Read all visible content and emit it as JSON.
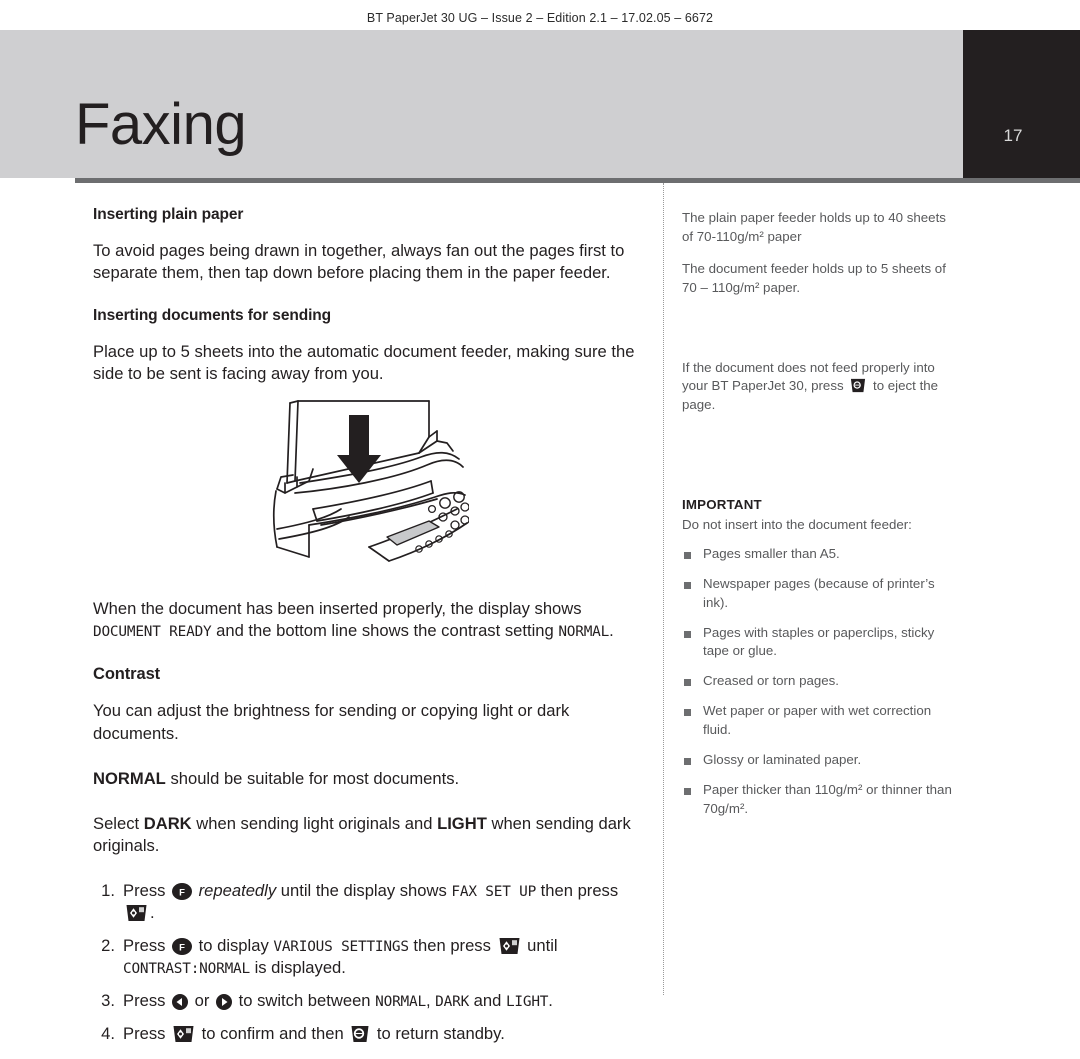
{
  "header": {
    "running_head": "BT PaperJet 30 UG – Issue 2 – Edition 2.1 – 17.02.05 – 6672",
    "chapter_title": "Faxing",
    "page_number": "17",
    "band_color": "#cfcfd1",
    "page_block_color": "#231f20",
    "rule_color": "#6d6e70"
  },
  "main": {
    "section1_heading": "Inserting plain paper",
    "section1_para": "To avoid pages being drawn in together, always fan out the pages first to separate them, then tap down before placing them in the paper feeder.",
    "section2_heading": "Inserting documents for sending",
    "section2_para": "Place up to 5 sheets into the automatic document feeder, making sure the side to be sent is facing away from you.",
    "figure_name": "fax-machine-document-feeder-illustration",
    "after_figure": {
      "part1": "When the document has been inserted properly, the display shows ",
      "lcd1": "DOCUMENT READY",
      "part2": " and the bottom line shows the contrast setting ",
      "lcd2": "NORMAL",
      "part3": "."
    },
    "contrast_heading": "Contrast",
    "contrast_para1": "You can adjust the brightness for sending or copying light or dark documents.",
    "contrast_para2": {
      "bold": "NORMAL",
      "rest": " should be suitable for most documents."
    },
    "contrast_para3": {
      "pre": "Select ",
      "bold1": "DARK",
      "mid": " when sending light originals and ",
      "bold2": "LIGHT",
      "post": " when sending dark originals."
    },
    "steps": [
      {
        "num": "1.",
        "t1": "Press ",
        "icon1": "function-key-f",
        "t2": " ",
        "italic": "repeatedly",
        "t3": " until the display shows ",
        "lcd1": "FAX SET UP",
        "t4": " then press ",
        "icon2": "start-key",
        "t5": "."
      },
      {
        "num": "2.",
        "t1": "Press ",
        "icon1": "function-key-f",
        "t2": " to display ",
        "lcd1": "VARIOUS SETTINGS",
        "t3": " then press ",
        "icon2": "start-key",
        "t4": " until ",
        "lcd2": "CONTRAST:NORMAL",
        "t5": " is displayed."
      },
      {
        "num": "3.",
        "t1": "Press ",
        "icon1": "arrow-left-key",
        "t2": " or ",
        "icon2": "arrow-right-key",
        "t3": " to switch between ",
        "lcd1": "NORMAL",
        "t4": ", ",
        "lcd2": "DARK",
        "t5": " and ",
        "lcd3": "LIGHT",
        "t6": "."
      },
      {
        "num": "4.",
        "t1": "Press ",
        "icon1": "start-key",
        "t2": " to confirm and then ",
        "icon2": "stop-key",
        "t3": " to return standby."
      }
    ]
  },
  "side": {
    "note1": "The plain paper feeder holds up to 40 sheets of 70-110g/m² paper",
    "note2": "The document feeder holds up to 5 sheets of 70 – 110g/m² paper.",
    "note3": {
      "pre": "If the document does not feed properly into your BT PaperJet 30, press ",
      "icon": "eject-key",
      "post": " to eject the page."
    },
    "important_title": "IMPORTANT",
    "important_intro": "Do not insert into the document feeder:",
    "bullets": [
      "Pages smaller than A5.",
      "Newspaper pages (because of printer’s ink).",
      "Pages with staples or paperclips, sticky tape or glue.",
      "Creased or torn pages.",
      "Wet paper or paper with wet correction fluid.",
      "Glossy or laminated paper.",
      "Paper thicker than 110g/m² or thinner than 70g/m²."
    ]
  }
}
